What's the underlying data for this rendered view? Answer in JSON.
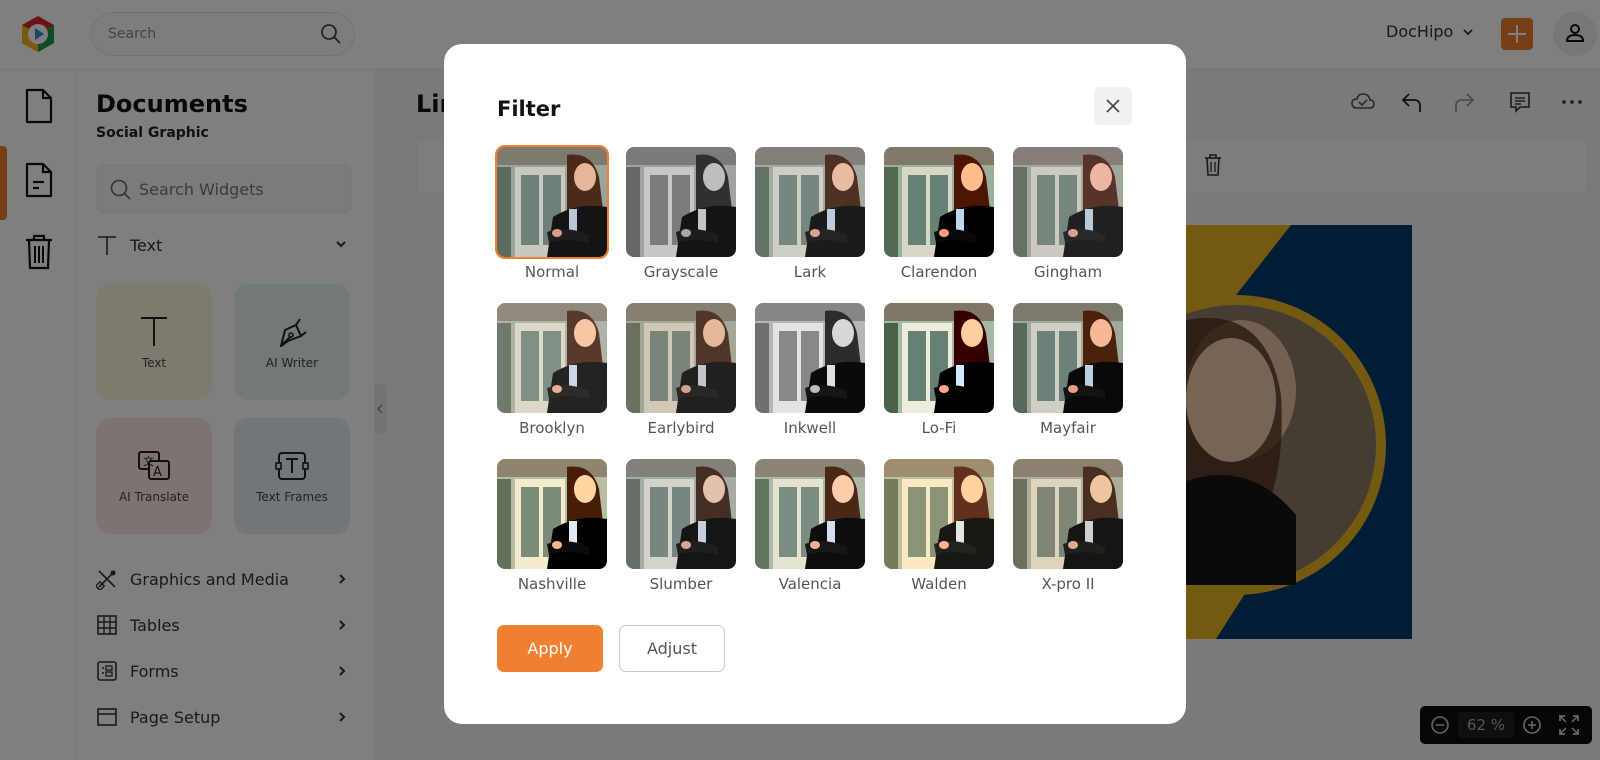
{
  "topbar": {
    "search_placeholder": "Search",
    "account_name": "DocHipo"
  },
  "rail": {
    "items": [
      {
        "name": "documents",
        "icon": "document-icon"
      },
      {
        "name": "templates",
        "icon": "document-lines-icon",
        "active": true
      },
      {
        "name": "trash",
        "icon": "trash-icon"
      }
    ]
  },
  "panel": {
    "title": "Documents",
    "subtitle": "Social Graphic",
    "search_placeholder": "Search Widgets",
    "text_section": "Text",
    "tiles": [
      {
        "label": "Text",
        "icon": "text-icon",
        "color": "#fbf6df"
      },
      {
        "label": "AI Writer",
        "icon": "pen-nib-icon",
        "color": "#e4f3ef"
      },
      {
        "label": "AI Translate",
        "icon": "translate-icon",
        "color": "#fbe7e7"
      },
      {
        "label": "Text Frames",
        "icon": "text-frame-icon",
        "color": "#e4ecf5"
      }
    ],
    "sections": [
      {
        "label": "Graphics and Media",
        "icon": "graphics-icon"
      },
      {
        "label": "Tables",
        "icon": "table-icon"
      },
      {
        "label": "Forms",
        "icon": "form-icon"
      },
      {
        "label": "Page Setup",
        "icon": "page-setup-icon"
      }
    ]
  },
  "editor": {
    "doc_title_partial": "Lin",
    "zoom_value": "62",
    "zoom_unit": "%"
  },
  "modal": {
    "title": "Filter",
    "filters": [
      "Normal",
      "Grayscale",
      "Lark",
      "Clarendon",
      "Gingham",
      "Brooklyn",
      "Earlybird",
      "Inkwell",
      "Lo-Fi",
      "Mayfair",
      "Nashville",
      "Slumber",
      "Valencia",
      "Walden",
      "X-pro II"
    ],
    "selected": "Normal",
    "apply_label": "Apply",
    "adjust_label": "Adjust"
  },
  "colors": {
    "accent": "#ef7f31",
    "canvas_navy": "#053b6c",
    "canvas_gold": "#e8b421"
  }
}
